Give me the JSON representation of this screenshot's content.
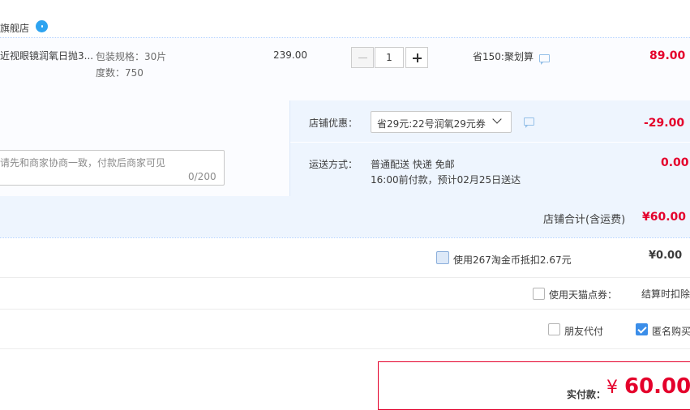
{
  "store": {
    "name": "旗舰店"
  },
  "item": {
    "title": "近视眼镜润氧日抛3...",
    "spec_package": "包装规格：30片",
    "spec_degree": "度数：750",
    "unit_price": "239.00",
    "quantity": "1",
    "promo": "省150:聚划算",
    "total": "89.00"
  },
  "message": {
    "placeholder": "请先和商家协商一致，付款后商家可见",
    "count": "0/200"
  },
  "shop_coupon": {
    "label": "店铺优惠：",
    "selected": "省29元:22号润氧29元券",
    "amount": "-29.00"
  },
  "delivery": {
    "label": "运送方式：",
    "method": "普通配送 快递 免邮",
    "time": "16:00前付款，预计02月25日送达",
    "fee": "0.00"
  },
  "shop_total": {
    "label": "店铺合计(含运费)",
    "value": "¥60.00"
  },
  "taobao_coin": {
    "label": "使用267淘金币抵扣2.67元",
    "value": "¥0.00",
    "checked": false
  },
  "tmall_points": {
    "label": "使用天猫点券：",
    "note": "结算时扣除",
    "checked": false
  },
  "friend_pay": {
    "label": "朋友代付",
    "checked": false
  },
  "anonymous": {
    "label": "匿名购买",
    "checked": true
  },
  "payment": {
    "label": "实付款：",
    "currency": "¥",
    "amount": "60.00"
  },
  "colors": {
    "accent_red": "#e4002b",
    "accent_blue": "#3b8ee9"
  }
}
